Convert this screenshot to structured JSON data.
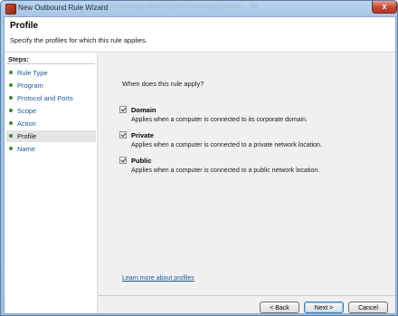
{
  "window": {
    "title": "New Outbound Rule Wizard",
    "title_behind": "RPC/Netcoring (WMI-Out)        RPC/Netcoring        Domain,...       No",
    "close_glyph": "x"
  },
  "header": {
    "title": "Profile",
    "subtitle": "Specify the profiles for which this rule applies."
  },
  "steps": {
    "label": "Steps:",
    "items": [
      {
        "label": "Rule Type",
        "active": false
      },
      {
        "label": "Program",
        "active": false
      },
      {
        "label": "Protocol and Ports",
        "active": false
      },
      {
        "label": "Scope",
        "active": false
      },
      {
        "label": "Action",
        "active": false
      },
      {
        "label": "Profile",
        "active": true
      },
      {
        "label": "Name",
        "active": false
      }
    ]
  },
  "main": {
    "question": "When does this rule apply?",
    "options": [
      {
        "title": "Domain",
        "desc": "Applies when a computer is connected to its corporate domain.",
        "checked": true
      },
      {
        "title": "Private",
        "desc": "Applies when a computer is connected to a private network location.",
        "checked": true
      },
      {
        "title": "Public",
        "desc": "Applies when a computer is connected to a public network location.",
        "checked": true
      }
    ],
    "learn_more": "Learn more about profiles"
  },
  "buttons": {
    "back": "< Back",
    "next": "Next >",
    "cancel": "Cancel"
  }
}
